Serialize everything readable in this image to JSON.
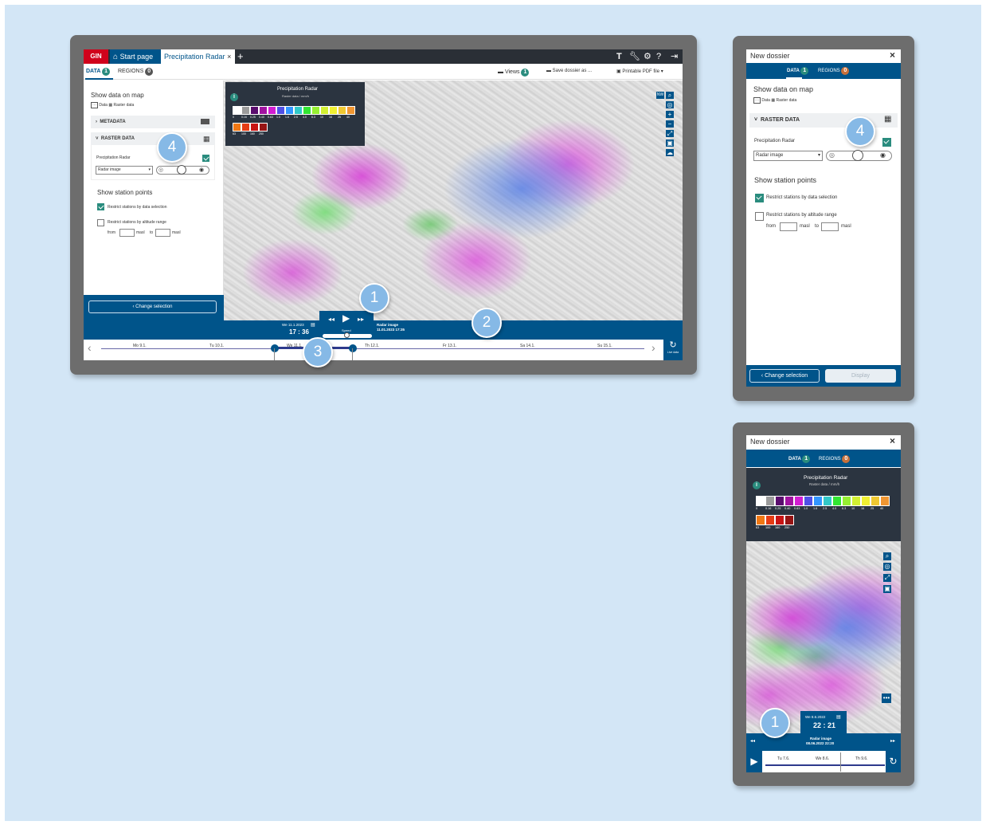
{
  "desktop": {
    "tabs": {
      "brand": "GIN",
      "start_page": "Start page",
      "active": "Precipitation Radar",
      "close": "×",
      "add": "+",
      "toolbar_icons": [
        "T",
        "wrench-icon",
        "gear-icon",
        "help-icon",
        "logout-icon"
      ]
    },
    "subtabs": {
      "data_label": "DATA",
      "data_count": "1",
      "regions_label": "REGIONS",
      "regions_count": "0"
    },
    "actions": {
      "views_label": "Views",
      "views_count": "1",
      "save_label": "Save dossier as ...",
      "pdf_label": "Printable PDF file"
    },
    "sidebar": {
      "title": "Show data on map",
      "legend_data": "Data",
      "legend_raster": "Raster data",
      "metadata_label": "METADATA",
      "raster_label": "RASTER DATA",
      "layer_name": "Precipitation Radar",
      "layer_select": "Radar image",
      "station_title": "Show station points",
      "restrict_data": "Restrict stations by data selection",
      "restrict_data_checked": true,
      "restrict_altitude": "Restrict stations by altitude range",
      "restrict_altitude_checked": false,
      "from_label": "from",
      "masl_label": "masl",
      "to_label": "to",
      "change_selection": "‹ Change selection"
    },
    "legend": {
      "title": "Precipitation Radar",
      "subtitle": "Raster data / mm/h",
      "info": "i",
      "values_row1": [
        "0",
        "0.16",
        "0.25",
        "0.40",
        "0.63",
        "1.0",
        "1.6",
        "2.5",
        "4.0",
        "6.3",
        "10",
        "16",
        "25",
        "40"
      ],
      "values_row2": [
        "63",
        "100",
        "160",
        "250"
      ],
      "colors_row1": [
        "#ffffff",
        "#9b9b9b",
        "#5a0d6e",
        "#a012a0",
        "#d21ed2",
        "#5050e6",
        "#3296ff",
        "#32c8c8",
        "#32e632",
        "#96f032",
        "#d2f032",
        "#f0f032",
        "#f0c832",
        "#f09632"
      ],
      "colors_row2": [
        "#f07814",
        "#e63c14",
        "#c81414",
        "#961414"
      ]
    },
    "map_tools": [
      "NW",
      "search-icon",
      "locate-icon",
      "zoom-in-icon",
      "zoom-out-icon",
      "extent-icon",
      "screenshot-icon",
      "layers-icon"
    ],
    "player": {
      "date": "We 11.1.2023",
      "time": "17 : 36",
      "speed_label": "Speed",
      "radar_label": "Radar image",
      "radar_time": "11.01.2023 17:35"
    },
    "timeline": {
      "days": [
        "Mo 9.1.",
        "Tu 10.1.",
        "We 11.1.",
        "Th 12.1.",
        "Fr 13.1.",
        "Sa 14.1.",
        "Su 15.1."
      ],
      "live_label": "Live data"
    },
    "callouts": [
      "1",
      "2",
      "3",
      "4"
    ]
  },
  "tablet": {
    "title": "New dossier",
    "close": "×",
    "tab_data": "DATA",
    "tab_data_count": "1",
    "tab_regions": "REGIONS",
    "tab_regions_count": "0",
    "show_title": "Show data on map",
    "legend_data": "Data",
    "legend_raster": "Raster data",
    "raster_label": "RASTER DATA",
    "layer_name": "Precipitation Radar",
    "layer_select": "Radar image",
    "station_title": "Show station points",
    "restrict_data": "Restrict stations by data selection",
    "restrict_altitude": "Restrict stations by altitude range",
    "from_label": "from",
    "masl_label": "masl",
    "to_label": "to",
    "change_selection": "Change selection",
    "display": "Display",
    "callout": "4"
  },
  "mobile": {
    "title": "New dossier",
    "close": "×",
    "tab_data": "DATA",
    "tab_data_count": "1",
    "tab_regions": "REGIONS",
    "tab_regions_count": "0",
    "legend_title": "Precipitation Radar",
    "legend_subtitle": "Raster data / mm/h",
    "legend_values_row1": [
      "0",
      "0.16",
      "0.25",
      "0.40",
      "0.63",
      "1.0",
      "1.6",
      "2.5",
      "4.0",
      "6.3",
      "10",
      "16",
      "25",
      "40"
    ],
    "legend_values_row2": [
      "63",
      "100",
      "160",
      "250"
    ],
    "date": "We 8.6.2022",
    "time": "22 : 21",
    "radar_label": "Radar image",
    "radar_time": "08.06.2022 22:20",
    "days": [
      "Tu 7.6.",
      "We 8.6.",
      "Th 9.6."
    ],
    "callout": "1"
  }
}
